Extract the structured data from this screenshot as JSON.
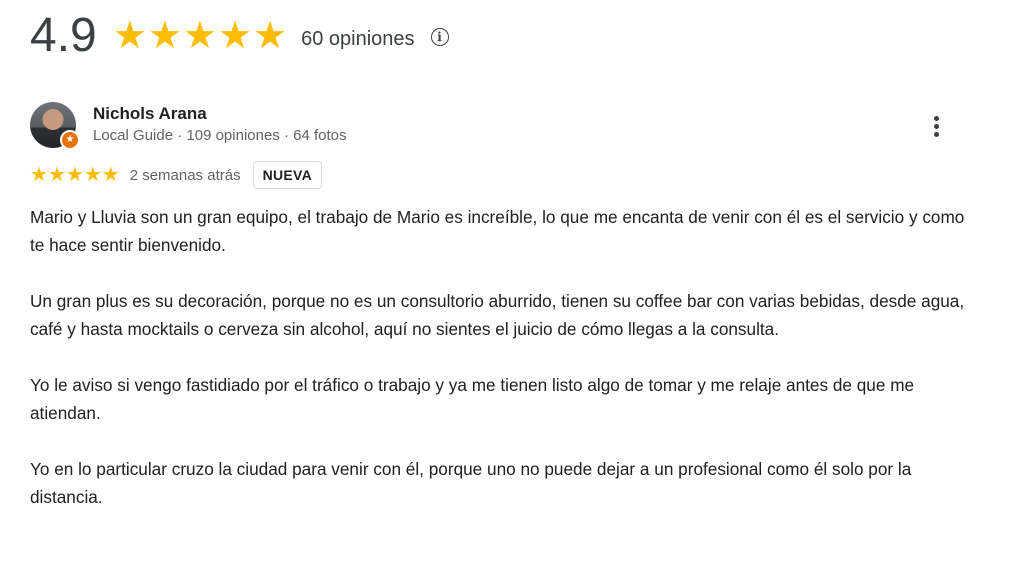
{
  "summary": {
    "score": "4.9",
    "stars": 5,
    "count_text": "60 opiniones",
    "info_icon": "info-icon"
  },
  "review": {
    "author": "Nichols Arana",
    "author_meta": "Local Guide · 109 opiniones · 64 fotos",
    "avatar_badge_icon": "local-guide-badge-icon",
    "rating": 5,
    "time_ago": "2 semanas atrás",
    "badge": "NUEVA",
    "more_icon": "more-vert-icon",
    "paragraphs": [
      "Mario y Lluvia son un gran equipo, el trabajo de Mario es increíble, lo que me encanta de venir con él es el servicio y como te hace sentir bienvenido.",
      "Un gran plus es su decoración, porque no es un consultorio aburrido, tienen su coffee bar con varias bebidas, desde agua, café y hasta mocktails o cerveza sin alcohol, aquí no sientes el juicio de cómo llegas a la consulta.",
      "Yo le aviso si vengo fastidiado por el tráfico o trabajo y ya me tienen listo algo de tomar y me relaje antes de que me atiendan.",
      "Yo en lo particular cruzo la ciudad para venir con él, porque uno no puede dejar a un profesional como él solo por la distancia."
    ]
  },
  "colors": {
    "star": "#fbbc04",
    "badge_orange": "#e8710a",
    "text_primary": "#202124",
    "text_secondary": "#5f6368"
  }
}
